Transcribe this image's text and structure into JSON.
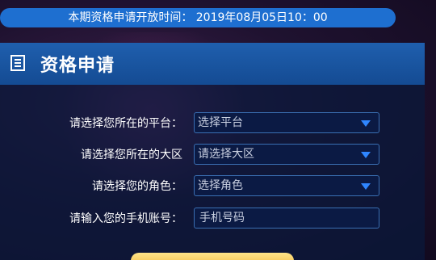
{
  "notice": {
    "text": "本期资格申请开放时间： 2019年08月05日10：00"
  },
  "panel": {
    "title": "资格申请"
  },
  "form": {
    "platform_label": "请选择您所在的平台：",
    "platform_value": "选择平台",
    "region_label": "请选择您所在的大区",
    "region_value": "请选择大区",
    "role_label": "请选择您的角色：",
    "role_value": "选择角色",
    "phone_label": "请输入您的手机账号：",
    "phone_placeholder": "手机号码"
  },
  "colors": {
    "notice_bar": "#1e6fd0",
    "header": "#1f5fae",
    "dropdown_arrow": "#2f86ff",
    "button": "#f1b73c"
  },
  "icons": {
    "header": "document-icon",
    "dropdown": "triangle-down-icon"
  }
}
